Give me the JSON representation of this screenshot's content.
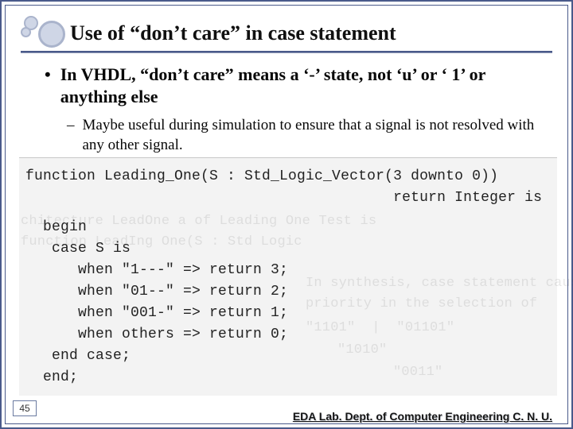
{
  "title": "Use of “don’t care” in case statement",
  "bullets": {
    "b1": "In VHDL, “don’t care” means a ‘-’ state, not ‘u’ or ‘ 1’ or anything else",
    "b2": "Maybe useful during simulation to ensure that a signal is not resolved with any other signal."
  },
  "code": {
    "l0": "function Leading_One(S : Std_Logic_Vector(3 downto 0))",
    "l1": "                                          return Integer is",
    "l2": "  begin",
    "l3": "   case S is",
    "l4": "      when \"1---\" => return 3;",
    "l5": "      when \"01--\" => return 2;",
    "l6": "      when \"001-\" => return 1;",
    "l7": "      when others => return 0;",
    "l8": "   end case;",
    "l9": "  end;"
  },
  "ghost": {
    "g1": "chitecture LeadOne a of Leading One Test is",
    "g2": "function LeadIng One(S : Std Logic",
    "g3": "In synthesis, case statement causes",
    "g4": "priority in the selection of",
    "g5": "\"1101\"  |  \"01101\"",
    "g6": "\"1010\"",
    "g7": "\"0011\""
  },
  "slide_number": "45",
  "footer": "EDA Lab. Dept. of Computer Engineering C. N. U."
}
